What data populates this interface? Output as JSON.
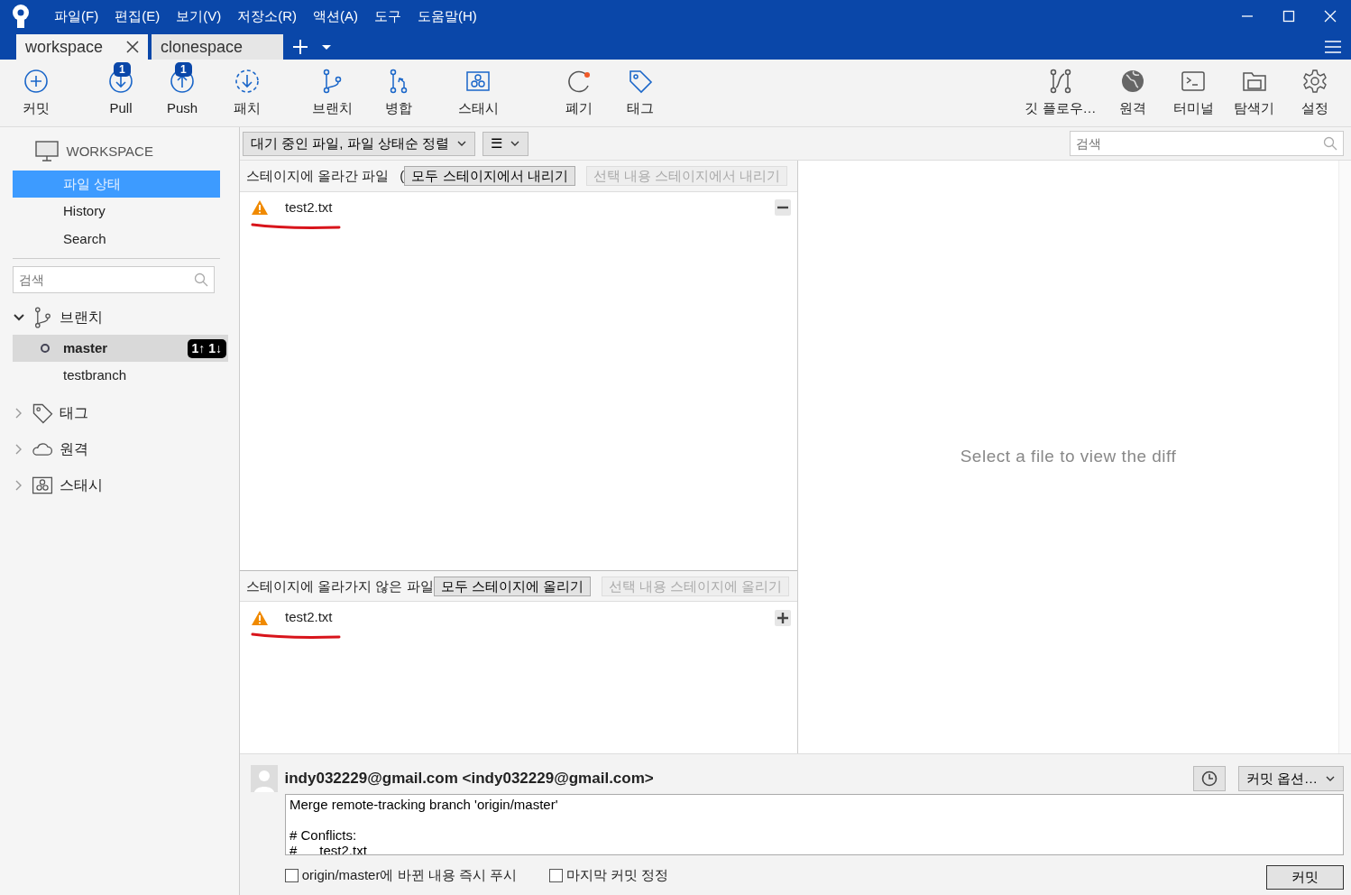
{
  "app_menu": [
    "파일(F)",
    "편집(E)",
    "보기(V)",
    "저장소(R)",
    "액션(A)",
    "도구",
    "도움말(H)"
  ],
  "tabs": [
    {
      "label": "workspace",
      "selected": true
    },
    {
      "label": "clonespace",
      "selected": false
    }
  ],
  "toolbar": {
    "left": [
      {
        "label": "커밋"
      },
      {
        "label": "Pull",
        "badge": "1"
      },
      {
        "label": "Push",
        "badge": "1"
      },
      {
        "label": "패치"
      },
      {
        "label": "브랜치"
      },
      {
        "label": "병합"
      },
      {
        "label": "스태시"
      },
      {
        "label": "폐기"
      },
      {
        "label": "태그"
      }
    ],
    "right": [
      {
        "label": "깃 플로우…"
      },
      {
        "label": "원격"
      },
      {
        "label": "터미널"
      },
      {
        "label": "탐색기"
      },
      {
        "label": "설정"
      }
    ]
  },
  "sidebar": {
    "workspace_label": "WORKSPACE",
    "views": [
      {
        "label": "파일 상태",
        "selected": true
      },
      {
        "label": "History",
        "selected": false
      },
      {
        "label": "Search",
        "selected": false
      }
    ],
    "search": {
      "placeholder": "검색"
    },
    "groups": [
      {
        "label": "브랜치",
        "expanded": true,
        "children": [
          {
            "label": "master",
            "current": true,
            "selected": true,
            "badge": "1↑ 1↓"
          },
          {
            "label": "testbranch",
            "current": false,
            "selected": false
          }
        ]
      },
      {
        "label": "태그",
        "expanded": false
      },
      {
        "label": "원격",
        "expanded": false
      },
      {
        "label": "스태시",
        "expanded": false
      }
    ]
  },
  "filter": {
    "sort_dropdown": "대기 중인 파일, 파일 상태순 정렬",
    "view_dropdown": "☰"
  },
  "search": {
    "placeholder": "검색"
  },
  "staged": {
    "title": "스테이지에 올라간 파일",
    "paren": "(",
    "buttons": [
      {
        "label": "모두 스테이지에서 내리기",
        "disabled": false
      },
      {
        "label": "선택 내용 스테이지에서 내리기",
        "disabled": true
      }
    ],
    "files": [
      {
        "name": "test2.txt"
      }
    ]
  },
  "unstaged": {
    "title": "스테이지에 올라가지 않은 파일",
    "buttons": [
      {
        "label": "모두 스테이지에 올리기",
        "disabled": false
      },
      {
        "label": "선택 내용 스테이지에 올리기",
        "disabled": true
      }
    ],
    "files": [
      {
        "name": "test2.txt"
      }
    ]
  },
  "diff": {
    "message": "Select a file to view the diff"
  },
  "commit": {
    "author": "indy032229@gmail.com <indy032229@gmail.com>",
    "options": "커밋 옵션…",
    "message": "Merge remote-tracking branch 'origin/master'\n\n# Conflicts:\n#\ttest2.txt",
    "checkboxes": [
      {
        "label": "origin/master에 바뀐 내용 즉시 푸시",
        "checked": false
      },
      {
        "label": "마지막 커밋 정정",
        "checked": false
      }
    ],
    "submit": "커밋"
  }
}
